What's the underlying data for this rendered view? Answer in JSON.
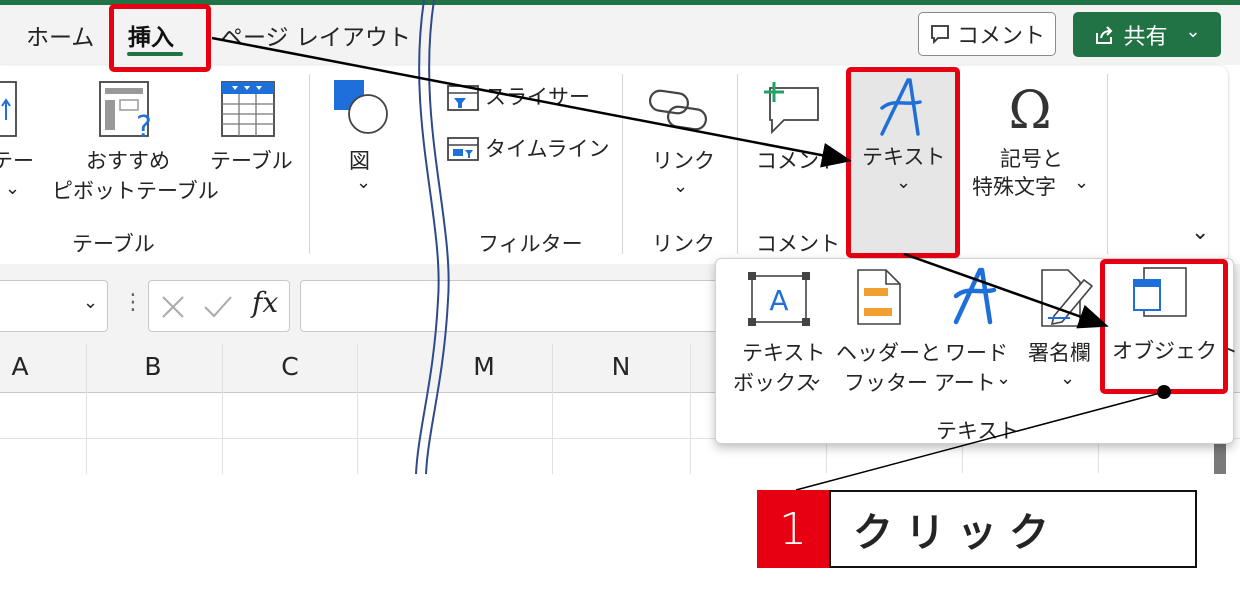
{
  "tabs": {
    "home": "ホーム",
    "insert": "挿入",
    "page_layout": "ページ レイアウト"
  },
  "header": {
    "comment_label": "コメント",
    "share_label": "共有",
    "share_chevron": "⌄"
  },
  "ribbon": {
    "pivot_partial_label": "テー",
    "recommended_pivot_line1": "おすすめ",
    "recommended_pivot_line2": "ピボットテーブル",
    "table_label": "テーブル",
    "group_table": "テーブル",
    "shapes_label": "図",
    "slicer_label": "スライサー",
    "timeline_label": "タイムライン",
    "group_filter": "フィルター",
    "link_label": "リンク",
    "group_link": "リンク",
    "comment_label": "コメント",
    "group_comment": "コメント",
    "text_label": "テキスト",
    "symbol_line1": "記号と",
    "symbol_line2": "特殊文字",
    "chevron": "⌄"
  },
  "formula_bar": {
    "fx_label": "fx"
  },
  "columns": [
    "A",
    "B",
    "C",
    "M",
    "N"
  ],
  "text_dropdown": {
    "textbox_line1": "テキスト",
    "textbox_line2": "ボックス",
    "header_footer_line1": "ヘッダーと",
    "header_footer_line2": "フッター",
    "wordart_line1": "ワード",
    "wordart_line2": "アート",
    "signature_label": "署名欄",
    "object_label": "オブジェクト",
    "group_label": "テキスト"
  },
  "callout": {
    "number": "1",
    "text": "クリック"
  },
  "colors": {
    "accent_green": "#217346",
    "highlight_red": "#e60012",
    "icon_blue": "#1e6fd9",
    "icon_orange": "#f0a030"
  }
}
